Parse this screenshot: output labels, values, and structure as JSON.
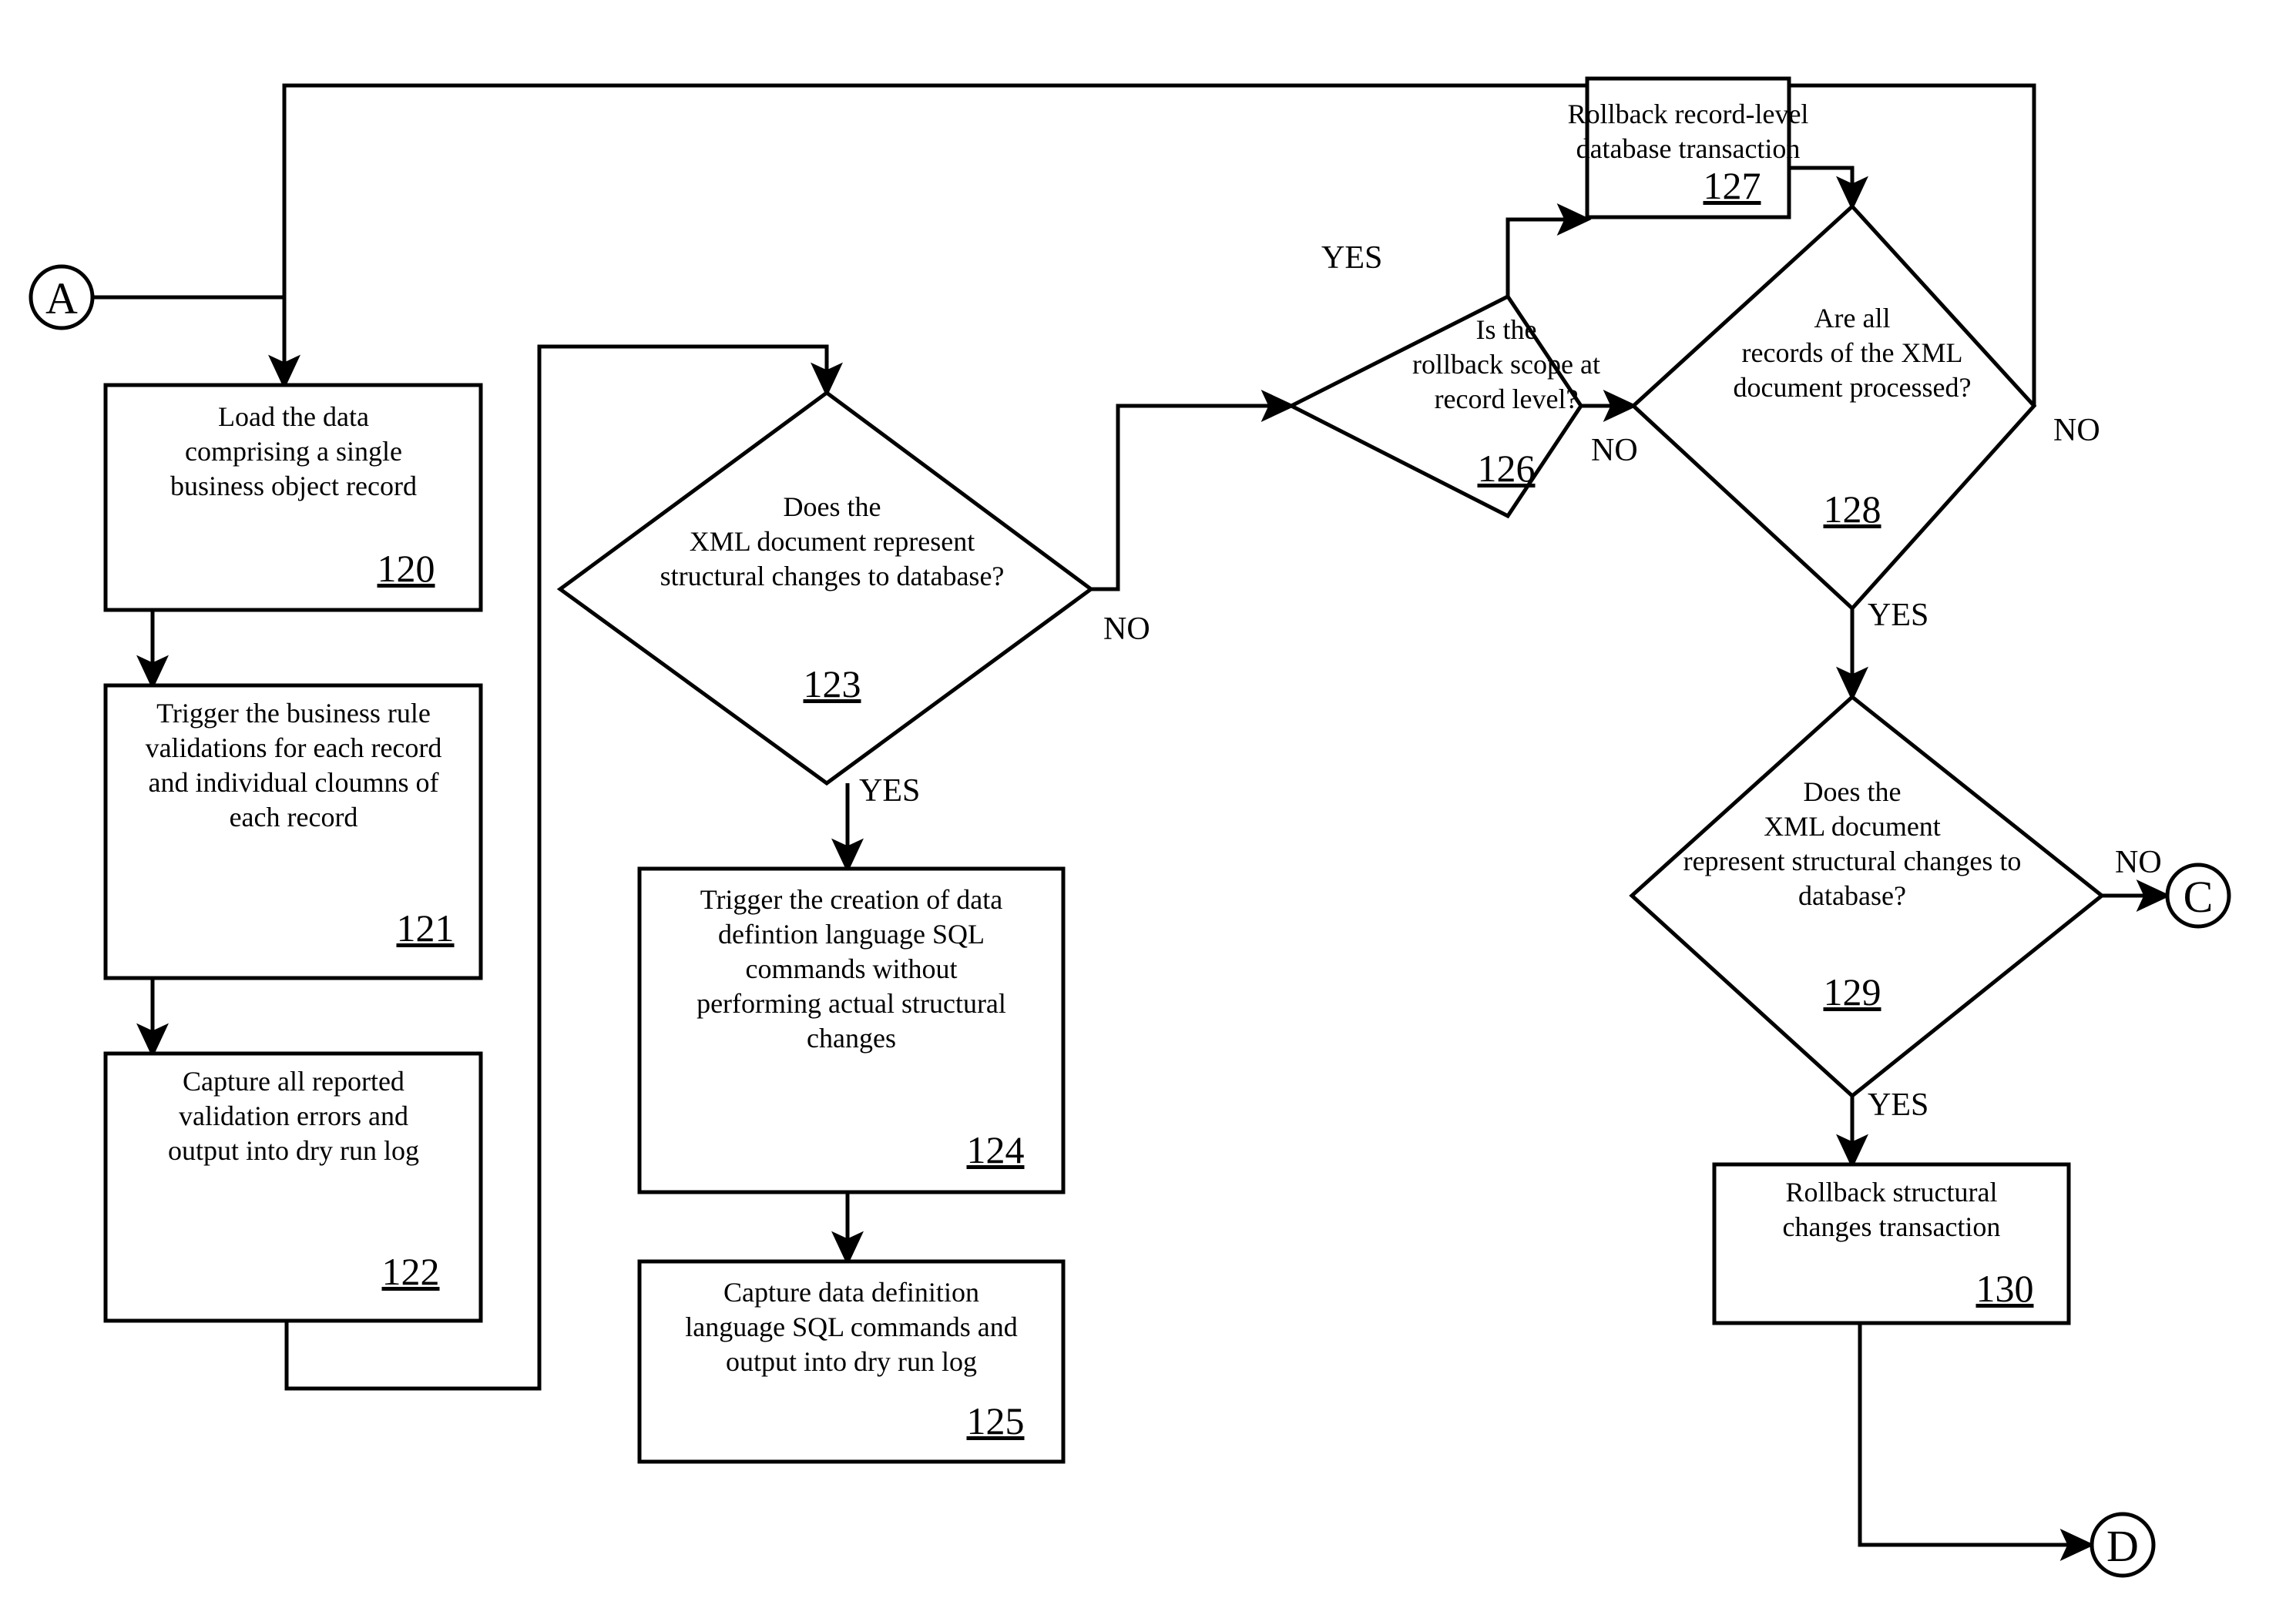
{
  "figure": {
    "type": "flowchart",
    "orientation": "landscape",
    "background_color": "#ffffff",
    "line_color": "#000000"
  },
  "connectors": [
    {
      "id": "A",
      "label": "A",
      "role": "entry-connector"
    },
    {
      "id": "C",
      "label": "C",
      "role": "exit-connector"
    },
    {
      "id": "D",
      "label": "D",
      "role": "exit-connector"
    }
  ],
  "nodes": [
    {
      "ref": "120",
      "shape": "process",
      "lines": [
        "Load the data",
        "comprising a single",
        "business object record"
      ]
    },
    {
      "ref": "121",
      "shape": "process",
      "lines": [
        "Trigger the business rule",
        "validations for each record",
        "and individual cloumns of",
        "each record"
      ]
    },
    {
      "ref": "122",
      "shape": "process",
      "lines": [
        "Capture all reported",
        "validation errors and",
        "output into dry run log"
      ]
    },
    {
      "ref": "123",
      "shape": "decision",
      "lines": [
        "Does the",
        "XML document represent",
        "structural changes to database?"
      ]
    },
    {
      "ref": "124",
      "shape": "process",
      "lines": [
        "Trigger the creation of data",
        "defintion language SQL",
        "commands without",
        "performing actual structural",
        "changes"
      ]
    },
    {
      "ref": "125",
      "shape": "process",
      "lines": [
        "Capture data definition",
        "language SQL commands and",
        "output into dry run log"
      ]
    },
    {
      "ref": "126",
      "shape": "decision",
      "lines": [
        "Is the",
        "rollback scope at",
        "record level?"
      ]
    },
    {
      "ref": "127",
      "shape": "process",
      "lines": [
        "Rollback record-level",
        "database transaction"
      ]
    },
    {
      "ref": "128",
      "shape": "decision",
      "lines": [
        "Are all",
        "records of the XML",
        "document processed?"
      ]
    },
    {
      "ref": "129",
      "shape": "decision",
      "lines": [
        "Does the",
        "XML document",
        "represent structural changes to",
        "database?"
      ]
    },
    {
      "ref": "130",
      "shape": "process",
      "lines": [
        "Rollback structural",
        "changes transaction"
      ]
    }
  ],
  "edge_labels": {
    "d123_no": "NO",
    "d123_yes": "YES",
    "d126_yes": "YES",
    "d126_no": "NO",
    "d128_no": "NO",
    "d128_yes": "YES",
    "d129_no": "NO",
    "d129_yes": "YES"
  },
  "edges": [
    {
      "from": "A",
      "to": "120",
      "label": ""
    },
    {
      "from": "120",
      "to": "121",
      "label": ""
    },
    {
      "from": "121",
      "to": "122",
      "label": ""
    },
    {
      "from": "122",
      "to": "123",
      "label": ""
    },
    {
      "from": "123",
      "to": "124",
      "label": "YES"
    },
    {
      "from": "123",
      "to": "126",
      "label": "NO"
    },
    {
      "from": "124",
      "to": "125",
      "label": ""
    },
    {
      "from": "126",
      "to": "127",
      "label": "YES"
    },
    {
      "from": "126",
      "to": "128",
      "label": "NO"
    },
    {
      "from": "127",
      "to": "128",
      "label": ""
    },
    {
      "from": "128",
      "to": "120",
      "label": "NO"
    },
    {
      "from": "128",
      "to": "129",
      "label": "YES"
    },
    {
      "from": "129",
      "to": "C",
      "label": "NO"
    },
    {
      "from": "129",
      "to": "130",
      "label": "YES"
    },
    {
      "from": "130",
      "to": "D",
      "label": ""
    }
  ]
}
